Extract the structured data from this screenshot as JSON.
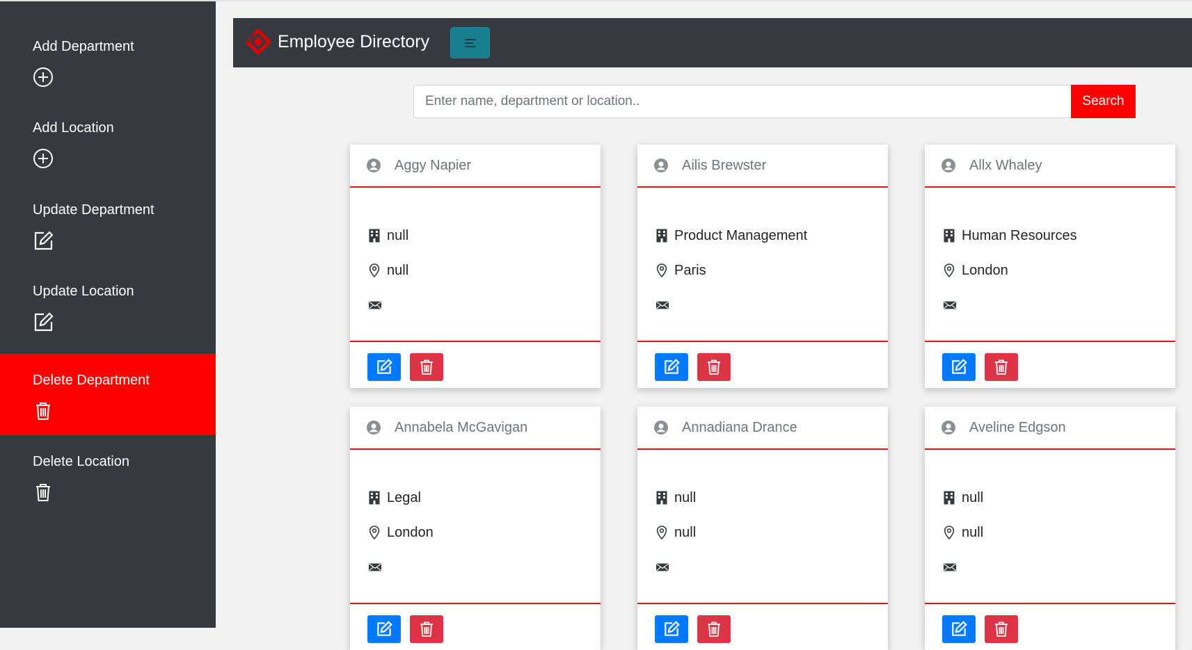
{
  "sidebar": {
    "items": [
      {
        "label": "Add Department",
        "icon": "plus-circle-icon"
      },
      {
        "label": "Add Location",
        "icon": "plus-circle-icon"
      },
      {
        "label": "Update Department",
        "icon": "edit-icon"
      },
      {
        "label": "Update Location",
        "icon": "edit-icon"
      },
      {
        "label": "Delete Department",
        "icon": "trash-icon",
        "active": true
      },
      {
        "label": "Delete Location",
        "icon": "trash-icon"
      }
    ]
  },
  "header": {
    "title": "Employee Directory",
    "menu_icon": "menu-toggle-icon",
    "logo_icon": "logo-icon"
  },
  "search": {
    "placeholder": "Enter name, department or location..",
    "value": "",
    "button_label": "Search"
  },
  "colors": {
    "accent": "#ff0000",
    "sidebar_bg": "#343a40",
    "edit_button": "#007bff",
    "delete_button": "#dc3545",
    "menu_button": "#17808f"
  },
  "employees": [
    {
      "name": "Aggy Napier",
      "department": "null",
      "location": "null",
      "email": ""
    },
    {
      "name": "Ailis Brewster",
      "department": "Product Management",
      "location": "Paris",
      "email": ""
    },
    {
      "name": "Allx Whaley",
      "department": "Human Resources",
      "location": "London",
      "email": ""
    },
    {
      "name": "Annabela McGavigan",
      "department": "Legal",
      "location": "London",
      "email": ""
    },
    {
      "name": "Annadiana Drance",
      "department": "null",
      "location": "null",
      "email": ""
    },
    {
      "name": "Aveline Edgson",
      "department": "null",
      "location": "null",
      "email": ""
    }
  ]
}
